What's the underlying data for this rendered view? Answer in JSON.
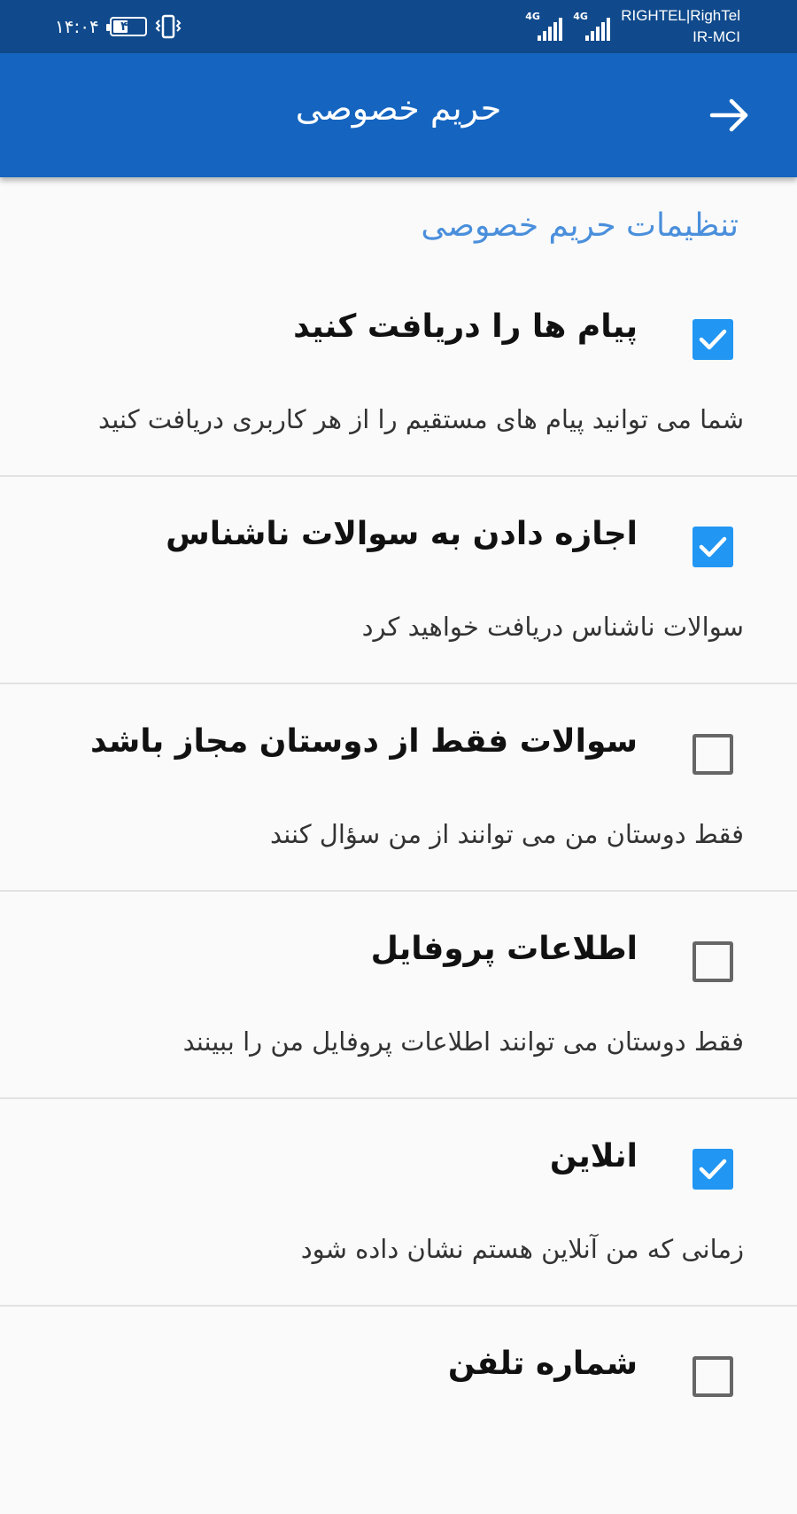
{
  "status_bar": {
    "time": "۱۴:۰۴",
    "battery_level": "۴۶",
    "battery_fraction": 0.46,
    "signal_1_label": "4G",
    "signal_2_label": "4G",
    "carrier_1": "RIGHTEL|RighTel",
    "carrier_2": "IR-MCI"
  },
  "app_bar": {
    "title": "حریم خصوصی",
    "back_icon": "arrow-forward-icon"
  },
  "section_header": "تنظیمات حریم خصوصی",
  "preferences": [
    {
      "title": "پیام ها را دریافت کنید",
      "summary": "شما می توانید پیام های مستقیم را از هر کاربری دریافت کنید",
      "checked": true
    },
    {
      "title": "اجازه دادن به سوالات ناشناس",
      "summary": "سوالات ناشناس دریافت خواهید کرد",
      "checked": true
    },
    {
      "title": "سوالات فقط از دوستان مجاز باشد",
      "summary": "فقط دوستان من می توانند از من سؤال کنند",
      "checked": false
    },
    {
      "title": "اطلاعات پروفایل",
      "summary": "فقط دوستان می توانند اطلاعات پروفایل من را ببینند",
      "checked": false
    },
    {
      "title": "انلاین",
      "summary": "زمانی که من آنلاین هستم نشان داده شود",
      "checked": true
    },
    {
      "title": "شماره تلفن",
      "summary": "",
      "checked": false
    }
  ],
  "colors": {
    "status_bar": "#104a8c",
    "app_bar": "#1565c0",
    "accent": "#2196f3",
    "section_header": "#4a8fdc"
  }
}
